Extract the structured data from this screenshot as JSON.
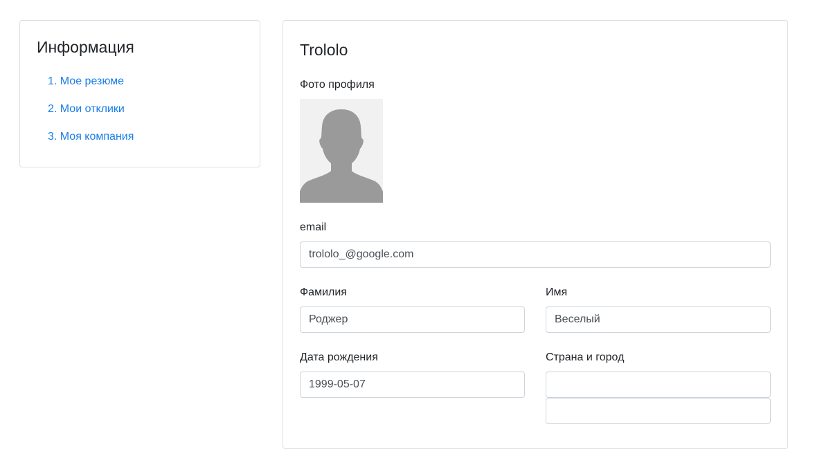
{
  "sidebar": {
    "title": "Информация",
    "items": [
      {
        "label": "1. Мое резюме"
      },
      {
        "label": "2. Мои отклики"
      },
      {
        "label": "3. Моя компания"
      }
    ]
  },
  "profile": {
    "title": "Trololo",
    "photo_label": "Фото профиля",
    "email_label": "email",
    "email_value": "trololo_@google.com",
    "last_name_label": "Фамилия",
    "last_name_value": "Роджер",
    "first_name_label": "Имя",
    "first_name_value": "Веселый",
    "birth_date_label": "Дата рождения",
    "birth_date_value": "1999-05-07",
    "location_label": "Страна и город",
    "country_value": "",
    "city_value": ""
  },
  "colors": {
    "link": "#1a7ee8",
    "border": "#ced4da",
    "avatar_silhouette": "#9a9a9a",
    "avatar_background": "#f1f1f1"
  }
}
